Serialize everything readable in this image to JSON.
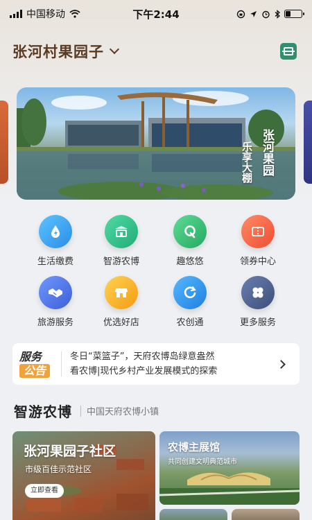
{
  "status_bar": {
    "carrier": "中国移动",
    "time": "下午2:44"
  },
  "header": {
    "title": "张河村果园子"
  },
  "banner": {
    "text_col1": "乐享大棚",
    "text_col2": "张河果园"
  },
  "services": [
    {
      "label": "生活缴费",
      "icon": "water-drop-bolt-icon",
      "color": "#3aa6f0"
    },
    {
      "label": "智游农博",
      "icon": "pavilion-icon",
      "color": "#2fbf8a"
    },
    {
      "label": "趣悠悠",
      "icon": "q-swirl-icon",
      "color": "#33c07a"
    },
    {
      "label": "领券中心",
      "icon": "ticket-icon",
      "color": "#f5674a"
    },
    {
      "label": "旅游服务",
      "icon": "handshake-icon",
      "color": "#4a78e0"
    },
    {
      "label": "优选好店",
      "icon": "storefront-icon",
      "color": "#f7b928"
    },
    {
      "label": "农创通",
      "icon": "refresh-c-icon",
      "color": "#2e90e8"
    },
    {
      "label": "更多服务",
      "icon": "four-petal-icon",
      "color": "#4f6393"
    }
  ],
  "notice": {
    "badge_line1": "服务",
    "badge_line2": "公告",
    "line1": "冬日“菜篮子”，天府农博岛绿意盎然",
    "line2": "看农博|现代乡村产业发展模式的探索"
  },
  "section": {
    "title": "智游农博",
    "subtitle": "中国天府农博小镇"
  },
  "cards": {
    "big_title": "张河果园子社区",
    "big_subtitle": "市级百佳示范社区",
    "big_button": "立即查看",
    "r1_title": "农博主展馆",
    "r1_subtitle": "共同创建文明典范城市"
  }
}
